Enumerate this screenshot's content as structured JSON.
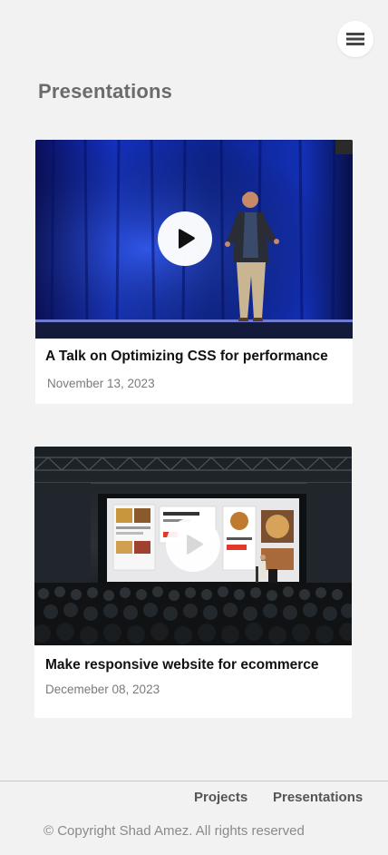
{
  "header": {
    "menu_icon": "hamburger-menu-icon"
  },
  "main": {
    "title": "Presentations",
    "cards": [
      {
        "title": "A Talk on Optimizing CSS for performance",
        "date": "November 13, 2023",
        "thumbnail": "speaker on stage with blue curtain",
        "play_icon": "play-icon"
      },
      {
        "title": "Make responsive website for ecommerce",
        "date": "Decemeber 08, 2023",
        "thumbnail": "conference hall with audience and projector screen",
        "play_icon": "play-icon"
      }
    ]
  },
  "footer": {
    "links": [
      "Projects",
      "Presentations"
    ],
    "copyright": "© Copyright Shad Amez. All rights reserved"
  },
  "colors": {
    "background": "#f2f2f2",
    "title": "#6b6b6b",
    "card_title": "#111111",
    "date": "#7a7a7a"
  }
}
